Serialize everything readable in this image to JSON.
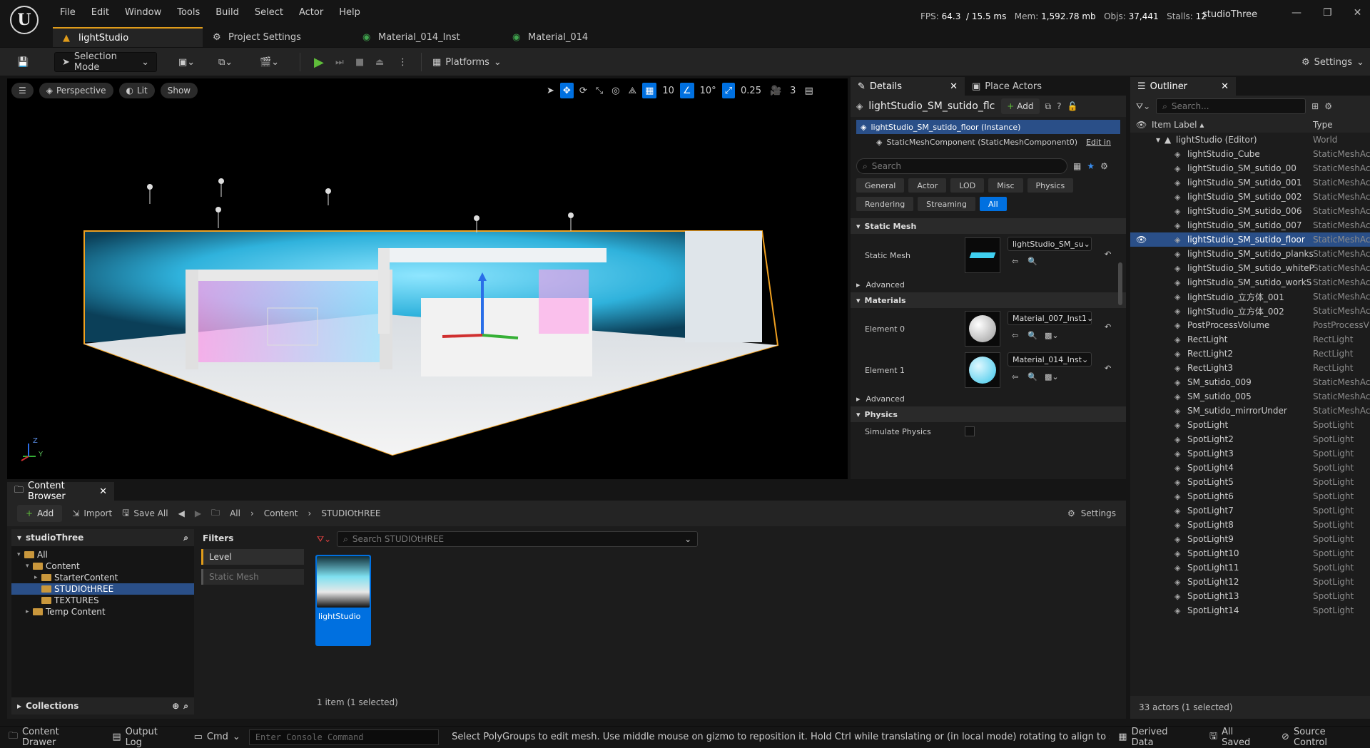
{
  "menu": [
    "File",
    "Edit",
    "Window",
    "Tools",
    "Build",
    "Select",
    "Actor",
    "Help"
  ],
  "stats": {
    "fps_label": "FPS:",
    "fps": "64.3",
    "ms": "/ 15.5 ms",
    "mem_label": "Mem:",
    "mem": "1,592.78 mb",
    "objs_label": "Objs:",
    "objs": "37,441",
    "stalls_label": "Stalls:",
    "stalls": "12"
  },
  "project_name": "studioThree",
  "tabs": [
    {
      "label": "lightStudio",
      "icon": "level-icon"
    },
    {
      "label": "Project Settings",
      "icon": "gear-icon"
    },
    {
      "label": "Material_014_Inst",
      "icon": "material-instance-icon"
    },
    {
      "label": "Material_014",
      "icon": "material-icon"
    }
  ],
  "toolbar": {
    "mode": "Selection Mode",
    "platforms": "Platforms",
    "settings": "Settings"
  },
  "viewport": {
    "perspective": "Perspective",
    "lit": "Lit",
    "show": "Show",
    "grid": "10",
    "angle": "10°",
    "scale": "0.25",
    "camera_speed": "3",
    "axis_z": "Z",
    "axis_y": "Y"
  },
  "details": {
    "tab_label": "Details",
    "place_actors": "Place Actors",
    "actor_name": "lightStudio_SM_sutido_flc",
    "add": "Add",
    "instance": "lightStudio_SM_sutido_floor (Instance)",
    "component": "StaticMeshComponent (StaticMeshComponent0)",
    "edit_in": "Edit in",
    "search_placeholder": "Search",
    "filters": [
      "General",
      "Actor",
      "LOD",
      "Misc",
      "Physics",
      "Rendering",
      "Streaming",
      "All"
    ],
    "section_static_mesh": "Static Mesh",
    "static_mesh_label": "Static Mesh",
    "static_mesh_value": "lightStudio_SM_su",
    "advanced": "Advanced",
    "section_materials": "Materials",
    "element0": "Element 0",
    "element0_value": "Material_007_Inst1",
    "element1": "Element 1",
    "element1_value": "Material_014_Inst",
    "section_physics": "Physics",
    "simulate_physics": "Simulate Physics"
  },
  "outliner": {
    "title": "Outliner",
    "search_placeholder": "Search...",
    "col_label": "Item Label",
    "col_type": "Type",
    "root": {
      "label": "lightStudio (Editor)",
      "type": "World"
    },
    "items": [
      {
        "label": "lightStudio_Cube",
        "type": "StaticMeshAc"
      },
      {
        "label": "lightStudio_SM_sutido_00",
        "type": "StaticMeshAc"
      },
      {
        "label": "lightStudio_SM_sutido_001",
        "type": "StaticMeshAc"
      },
      {
        "label": "lightStudio_SM_sutido_002",
        "type": "StaticMeshAc"
      },
      {
        "label": "lightStudio_SM_sutido_006",
        "type": "StaticMeshAc"
      },
      {
        "label": "lightStudio_SM_sutido_007",
        "type": "StaticMeshAc"
      },
      {
        "label": "lightStudio_SM_sutido_floor",
        "type": "StaticMeshAc",
        "selected": true
      },
      {
        "label": "lightStudio_SM_sutido_planks",
        "type": "StaticMeshAc"
      },
      {
        "label": "lightStudio_SM_sutido_whiteP",
        "type": "StaticMeshAc"
      },
      {
        "label": "lightStudio_SM_sutido_workS",
        "type": "StaticMeshAc"
      },
      {
        "label": "lightStudio_立方体_001",
        "type": "StaticMeshAc"
      },
      {
        "label": "lightStudio_立方体_002",
        "type": "StaticMeshAc"
      },
      {
        "label": "PostProcessVolume",
        "type": "PostProcessV"
      },
      {
        "label": "RectLight",
        "type": "RectLight"
      },
      {
        "label": "RectLight2",
        "type": "RectLight"
      },
      {
        "label": "RectLight3",
        "type": "RectLight"
      },
      {
        "label": "SM_sutido_009",
        "type": "StaticMeshAc"
      },
      {
        "label": "SM_sutido_005",
        "type": "StaticMeshAc"
      },
      {
        "label": "SM_sutido_mirrorUnder",
        "type": "StaticMeshAc"
      },
      {
        "label": "SpotLight",
        "type": "SpotLight"
      },
      {
        "label": "SpotLight2",
        "type": "SpotLight"
      },
      {
        "label": "SpotLight3",
        "type": "SpotLight"
      },
      {
        "label": "SpotLight4",
        "type": "SpotLight"
      },
      {
        "label": "SpotLight5",
        "type": "SpotLight"
      },
      {
        "label": "SpotLight6",
        "type": "SpotLight"
      },
      {
        "label": "SpotLight7",
        "type": "SpotLight"
      },
      {
        "label": "SpotLight8",
        "type": "SpotLight"
      },
      {
        "label": "SpotLight9",
        "type": "SpotLight"
      },
      {
        "label": "SpotLight10",
        "type": "SpotLight"
      },
      {
        "label": "SpotLight11",
        "type": "SpotLight"
      },
      {
        "label": "SpotLight12",
        "type": "SpotLight"
      },
      {
        "label": "SpotLight13",
        "type": "SpotLight"
      },
      {
        "label": "SpotLight14",
        "type": "SpotLight"
      }
    ],
    "count": "33 actors (1 selected)"
  },
  "content_browser": {
    "title": "Content Browser",
    "add": "Add",
    "import": "Import",
    "save_all": "Save All",
    "path": [
      "All",
      "Content",
      "STUDIOtHREE"
    ],
    "settings": "Settings",
    "tree_root": "studioThree",
    "tree": [
      {
        "label": "All",
        "indent": 0
      },
      {
        "label": "Content",
        "indent": 1
      },
      {
        "label": "StarterContent",
        "indent": 2
      },
      {
        "label": "STUDIOtHREE",
        "indent": 2,
        "selected": true
      },
      {
        "label": "TEXTURES",
        "indent": 2
      },
      {
        "label": "Temp Content",
        "indent": 1
      }
    ],
    "collections": "Collections",
    "filters_title": "Filters",
    "filter_level": "Level",
    "filter_static_mesh": "Static Mesh",
    "search_placeholder": "Search STUDIOtHREE",
    "asset_name": "lightStudio",
    "item_count": "1 item (1 selected)"
  },
  "status": {
    "content_drawer": "Content Drawer",
    "output_log": "Output Log",
    "cmd": "Cmd",
    "console_placeholder": "Enter Console Command",
    "message": "Select PolyGroups to edit mesh. Use middle mouse on gizmo to reposition it. Hold Ctrl while translating or (in local mode) rotating to align to scene. Shift and Ctrl c",
    "derived_data": "Derived Data",
    "all_saved": "All Saved",
    "source_control": "Source Control"
  }
}
